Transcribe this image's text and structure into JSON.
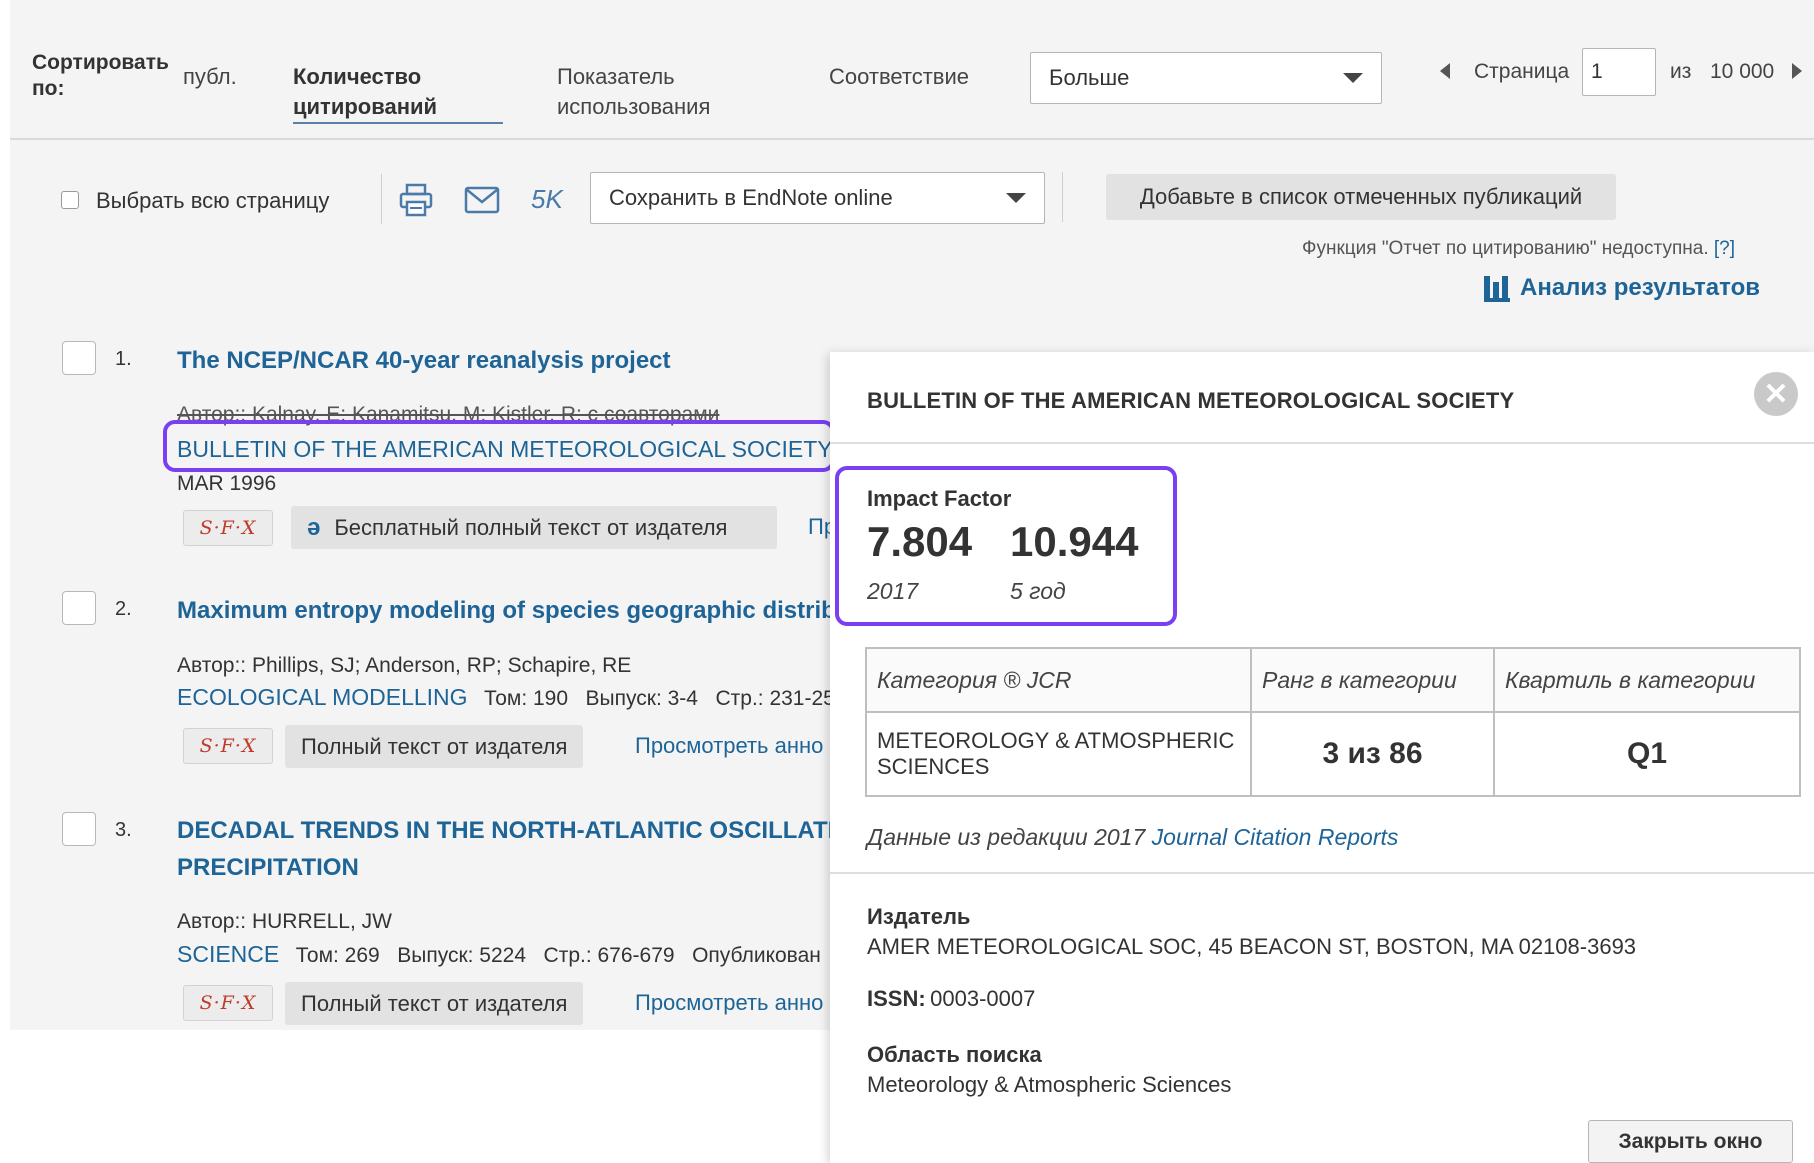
{
  "sort": {
    "label": "Сортировать по:",
    "options": [
      "публ.",
      "Количество цитирований",
      "Показатель использования",
      "Соответствие"
    ],
    "active_index": 1,
    "order_select": "Больше"
  },
  "pager": {
    "page_label": "Страница",
    "page_value": "1",
    "of_label": "из",
    "total": "10 000"
  },
  "toolbar": {
    "select_all": "Выбрать всю страницу",
    "count": "5K",
    "save_select": "Сохранить в EndNote online",
    "add_to_marked": "Добавьте в список отмеченных публикаций",
    "citation_report_note": "Функция \"Отчет по цитированию\" недоступна.",
    "help_link": "[?]",
    "analyze": "Анализ результатов"
  },
  "records": [
    {
      "num": "1.",
      "title": "The NCEP/NCAR 40-year reanalysis project",
      "authors": "Автор:: Kalnay, E; Kanamitsu, M; Kistler, R; с соавторами",
      "journal": "BULLETIN OF THE AMERICAN METEOROLOGICAL SOCIETY",
      "date": "MAR 1996",
      "fulltext": "Бесплатный полный текст от издателя",
      "extra": "Пр"
    },
    {
      "num": "2.",
      "title": "Maximum entropy modeling of species geographic distrib",
      "authors": "Автор:: Phillips, SJ; Anderson, RP; Schapire, RE",
      "journal": "ECOLOGICAL MODELLING",
      "details": "Том: 190   Выпуск: 3-4   Стр.: 231-25",
      "fulltext": "Полный текст от издателя",
      "abstract": "Просмотреть анно"
    },
    {
      "num": "3.",
      "title_line1": "DECADAL TRENDS IN THE NORTH-ATLANTIC OSCILLATION",
      "title_line2": "PRECIPITATION",
      "authors": "Автор:: HURRELL, JW",
      "journal": "SCIENCE",
      "details": "Том: 269   Выпуск: 5224   Стр.: 676-679   Опубликован",
      "fulltext": "Полный текст от издателя",
      "abstract": "Просмотреть анно"
    }
  ],
  "sfx_label": "S·F·X",
  "popup": {
    "title": "BULLETIN OF THE AMERICAN METEOROLOGICAL SOCIETY",
    "impact_label": "Impact Factor",
    "if_value": "7.804",
    "if_year": "2017",
    "if5_value": "10.944",
    "if5_year": "5 год",
    "table": {
      "headers": [
        "Категория ® JCR",
        "Ранг в категории",
        "Квартиль в категории"
      ],
      "row": [
        "METEOROLOGY & ATMOSPHERIC SCIENCES",
        "3 из 86",
        "Q1"
      ]
    },
    "source_prefix": "Данные из редакции 2017",
    "source_link": "Journal Citation Reports",
    "publisher_label": "Издатель",
    "publisher_value": "AMER METEOROLOGICAL SOC, 45 BEACON ST, BOSTON, MA 02108-3693",
    "issn_label": "ISSN:",
    "issn_value": "0003-0007",
    "area_label": "Область поиска",
    "area_value": "Meteorology & Atmospheric Sciences",
    "close_button": "Закрыть окно"
  },
  "colors": {
    "link": "#1e6496",
    "highlight": "#7b3ff2",
    "background": "#f4f4f4"
  }
}
